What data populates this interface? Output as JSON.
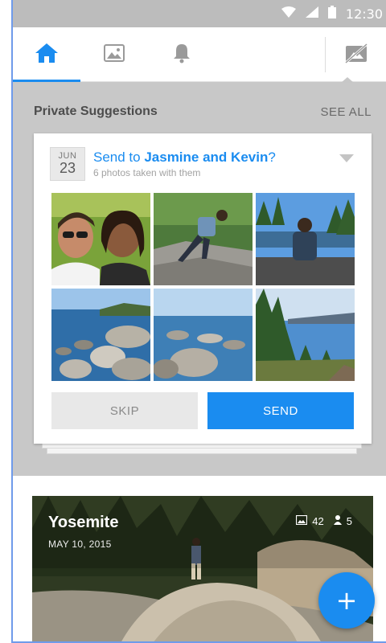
{
  "status_bar": {
    "time": "12:30",
    "icons": [
      "wifi-icon",
      "signal-icon",
      "battery-icon"
    ]
  },
  "nav": {
    "tabs": [
      {
        "icon": "home-icon",
        "active": true
      },
      {
        "icon": "photos-icon",
        "active": false
      },
      {
        "icon": "bell-icon",
        "active": false
      }
    ],
    "right_icon": "share-off-icon"
  },
  "suggestions": {
    "title": "Private Suggestions",
    "see_all": "SEE ALL"
  },
  "card": {
    "date_month": "JUN",
    "date_day": "23",
    "title_prefix": "Send to ",
    "title_names": "Jasmine and Kevin",
    "title_suffix": "?",
    "subtitle": "6 photos taken with them",
    "photo_count": 6,
    "skip_label": "SKIP",
    "send_label": "SEND"
  },
  "album": {
    "title": "Yosemite",
    "date": "MAY 10, 2015",
    "photo_count": "42",
    "people_count": "5"
  },
  "fab": {
    "label": "+"
  },
  "colors": {
    "accent": "#1a8cf0",
    "panel": "#c8c8c8",
    "status_bar": "#bcbcbc"
  }
}
